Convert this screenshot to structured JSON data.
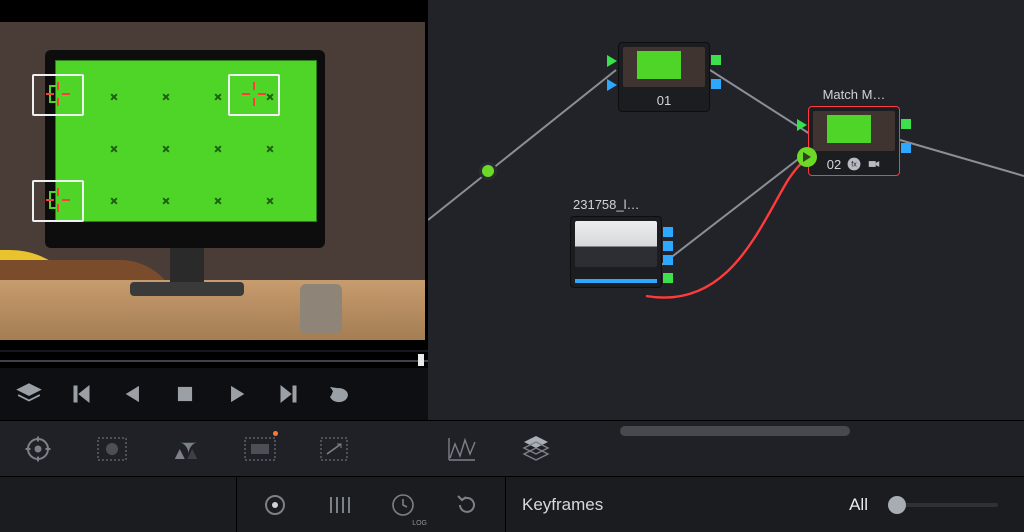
{
  "viewer": {
    "tracking_markers": 3,
    "screen_crosses": 12
  },
  "nodes": {
    "n1": {
      "label": "01",
      "title": ""
    },
    "n2": {
      "label": "02",
      "title": "Match M…"
    },
    "n3": {
      "label": "",
      "title": "231758_l…"
    }
  },
  "bottom": {
    "panel_label": "Keyframes",
    "scope_label": "All"
  },
  "icons": {
    "layers": "layers",
    "prev": "skip-start",
    "rev": "play-reverse",
    "stop": "stop",
    "play": "play",
    "next": "skip-end",
    "loop": "loop",
    "qualifier": "qualifier",
    "window": "window",
    "tracker": "tracker",
    "mask": "magic-mask",
    "resize": "resize-box",
    "curves": "curves",
    "nodes": "node-stack",
    "circle": "circle",
    "bars": "bars",
    "log": "log",
    "undo": "undo"
  }
}
